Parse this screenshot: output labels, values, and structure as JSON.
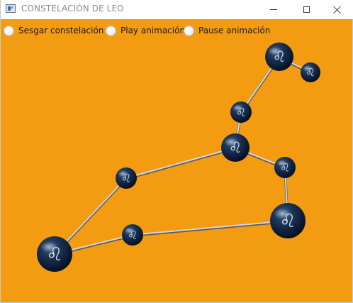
{
  "window": {
    "title": "CONSTELACIÓN DE LEO",
    "background_color": "#f39c11",
    "icons": {
      "app": "app-window-icon",
      "minimize": "minimize-icon",
      "maximize": "maximize-icon",
      "close": "close-icon"
    }
  },
  "controls": {
    "radios": [
      {
        "label": "Sesgar constelación",
        "selected": false
      },
      {
        "label": "Play animación",
        "selected": false
      },
      {
        "label": "Pause animación",
        "selected": false
      }
    ]
  },
  "constellation": {
    "star_symbol": "♌",
    "star_color": "#0d2140",
    "link_color": "#d8d8d8",
    "star_count": 9,
    "link_count": 9
  }
}
